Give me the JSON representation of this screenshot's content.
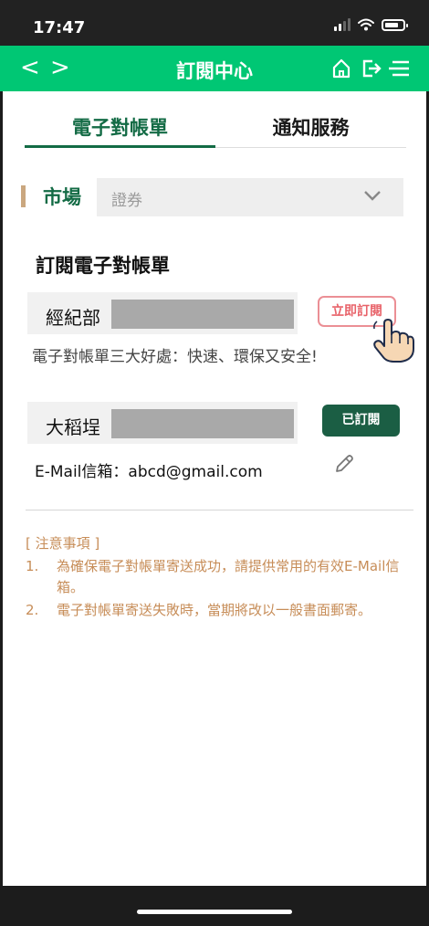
{
  "status_bar": {
    "time": "17:47"
  },
  "nav": {
    "back_label": "<",
    "forward_label": ">",
    "title": "訂閱中心"
  },
  "tabs": [
    {
      "label": "電子對帳單",
      "active": true
    },
    {
      "label": "通知服務",
      "active": false
    }
  ],
  "market": {
    "label": "市場",
    "selected": "證券"
  },
  "section": {
    "title": "訂閱電子對帳單"
  },
  "accounts": [
    {
      "branch": "經紀部",
      "button_label": "立即訂閱",
      "benefit": "電子對帳單三大好處：快速、環保又安全!"
    },
    {
      "branch": "大稻埕",
      "button_label": "已訂閱",
      "email": "E-Mail信箱：abcd@gmail.com"
    }
  ],
  "notes": {
    "title": "[ 注意事項 ]",
    "items": [
      {
        "num": "1.",
        "text": "為確保電子對帳單寄送成功，請提供常用的有效E-Mail信箱。"
      },
      {
        "num": "2.",
        "text": "電子對帳單寄送失敗時，當期將改以一般書面郵寄。"
      }
    ]
  },
  "colors": {
    "nav_green": "#00c774",
    "dark_green": "#136b45",
    "subscribed_green": "#1b5e44",
    "subscribe_red": "#e8636a",
    "note_orange": "#c78d58"
  },
  "icons": [
    "home-icon",
    "logout-icon",
    "menu-icon",
    "chevron-down-icon",
    "pointer-hand-icon",
    "pencil-edit-icon"
  ]
}
